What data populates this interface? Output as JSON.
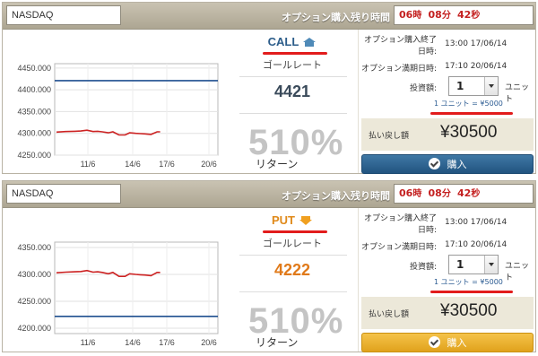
{
  "panels": [
    {
      "symbol": "NASDAQ",
      "remaining_label": "オプション購入残り時間",
      "timer": {
        "h": "06",
        "h_unit": "時",
        "m": "08",
        "m_unit": "分",
        "s": "42",
        "s_unit": "秒"
      },
      "direction": "CALL",
      "direction_icon": "house-up-arrow-icon",
      "direction_color": "#2c5d8a",
      "goal_label": "ゴールレート",
      "goal_value": "4421",
      "goal_color": "#3a4a5a",
      "payout_percent": "510%",
      "return_label": "リターン",
      "purchase_end_label_1": "オプション購入終了",
      "purchase_end_label_2": "日時:",
      "purchase_end_value": "13:00 17/06/14",
      "expiry_label": "オプション満期日時:",
      "expiry_value": "17:10 20/06/14",
      "quantity_label": "投資額:",
      "quantity_value": "1",
      "unit_label": "ユニット",
      "unit_conversion": "1 ユニット = ¥5000",
      "payout_label": "払い戻し額",
      "payout_value": "¥30500",
      "buy_label": "購入",
      "buy_color": "#2c5f8c",
      "chart_data": {
        "type": "line",
        "y_ticks": [
          "4450.000",
          "4400.000",
          "4350.000",
          "4300.000",
          "4250.000"
        ],
        "x_ticks": [
          "11/6",
          "14/6",
          "17/6",
          "20/6"
        ],
        "ylim": [
          4250,
          4460
        ],
        "goal_line": 4421,
        "line_color": "#cc2222",
        "goal_color": "#1f4f8f"
      }
    },
    {
      "symbol": "NASDAQ",
      "remaining_label": "オプション購入残り時間",
      "timer": {
        "h": "06",
        "h_unit": "時",
        "m": "08",
        "m_unit": "分",
        "s": "42",
        "s_unit": "秒"
      },
      "direction": "PUT",
      "direction_icon": "arrow-down-icon",
      "direction_color": "#e08a1a",
      "goal_label": "ゴールレート",
      "goal_value": "4222",
      "goal_color": "#e07a1a",
      "payout_percent": "510%",
      "return_label": "リターン",
      "purchase_end_label_1": "オプション購入終了",
      "purchase_end_label_2": "日時:",
      "purchase_end_value": "13:00 17/06/14",
      "expiry_label": "オプション満期日時:",
      "expiry_value": "17:10 20/06/14",
      "quantity_label": "投資額:",
      "quantity_value": "1",
      "unit_label": "ユニット",
      "unit_conversion": "1 ユニット = ¥5000",
      "payout_label": "払い戻し額",
      "payout_value": "¥30500",
      "buy_label": "購入",
      "buy_color": "#e6a928",
      "chart_data": {
        "type": "line",
        "y_ticks": [
          "4350.000",
          "4300.000",
          "4250.000",
          "4200.000"
        ],
        "x_ticks": [
          "11/6",
          "14/6",
          "17/6",
          "20/6"
        ],
        "ylim": [
          4190,
          4360
        ],
        "goal_line": 4222,
        "line_color": "#cc2222",
        "goal_color": "#1f4f8f"
      }
    }
  ]
}
